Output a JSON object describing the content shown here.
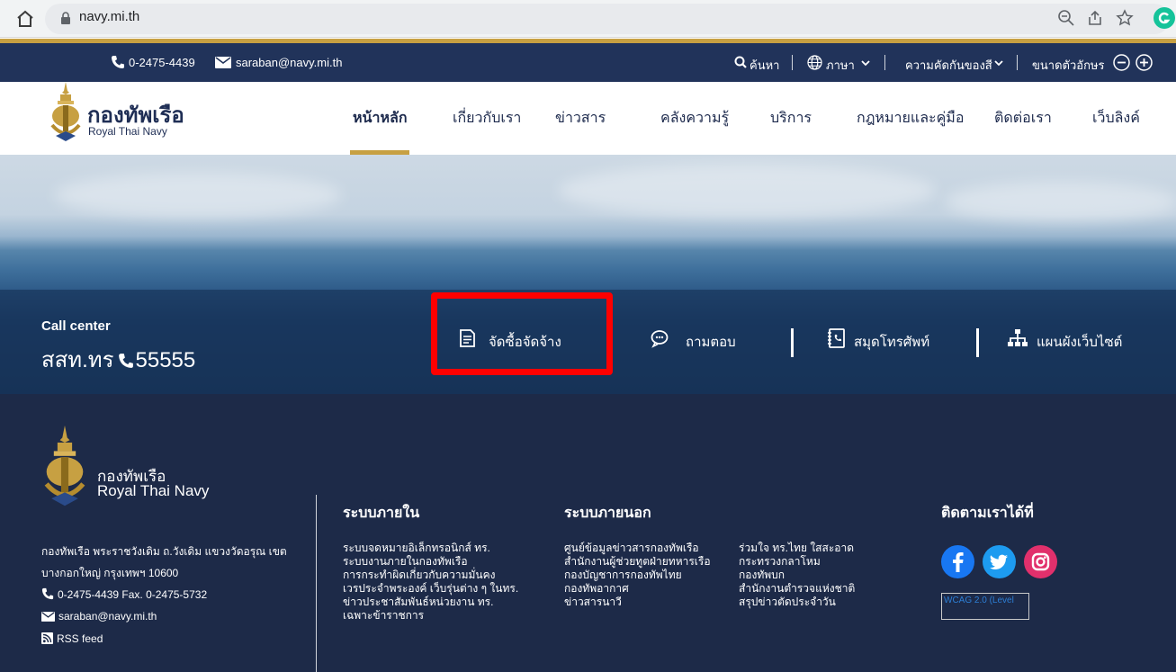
{
  "browser": {
    "url": "navy.mi.th"
  },
  "utility": {
    "phone": "0-2475-4439",
    "email": "saraban@navy.mi.th",
    "search": "ค้นหา",
    "language": "ภาษา",
    "contrast": "ความคัดกันของสี",
    "font_size": "ขนาดตัวอักษร"
  },
  "header": {
    "logo_th": "กองทัพเรือ",
    "logo_en": "Royal Thai Navy",
    "nav": [
      "หน้าหลัก",
      "เกี่ยวกับเรา",
      "ข่าวสาร",
      "คลังความรู้",
      "บริการ",
      "กฎหมายและคู่มือ",
      "ติดต่อเรา",
      "เว็บลิงค์"
    ]
  },
  "hero": {
    "call_center_label": "Call center",
    "call_center_prefix": "สสท.ทร",
    "call_center_number": "55555",
    "quick_links": [
      "จัดซื้อจัดจ้าง",
      "ถามตอบ",
      "สมุดโทรศัพท์",
      "แผนผังเว็บไซต์"
    ]
  },
  "footer": {
    "logo_th": "กองทัพเรือ",
    "logo_en": "Royal Thai Navy",
    "address": "กองทัพเรือ พระราชวังเดิม ถ.วังเดิม แขวงวัดอรุณ เขตบางกอกใหญ่ กรุงเทพฯ 10600",
    "phone_fax": "0-2475-4439 Fax. 0-2475-5732",
    "email": "saraban@navy.mi.th",
    "rss": "RSS feed",
    "internal_heading": "ระบบภายใน",
    "internal_links": [
      "ระบบจดหมายอิเล็กทรอนิกส์ ทร.",
      "ระบบงานภายในกองทัพเรือ",
      "การกระทำผิดเกี่ยวกับความมั่นคง",
      "เวรประจำพระองค์ เว็บรุ่นต่าง ๆ ในทร.",
      "ข่าวประชาสัมพันธ์หน่วยงาน ทร.",
      "เฉพาะข้าราชการ"
    ],
    "external_heading": "ระบบภายนอก",
    "external_links_col1": [
      "ศูนย์ข้อมูลข่าวสารกองทัพเรือ",
      "สำนักงานผู้ช่วยทูตฝ่ายทหารเรือ",
      "กองบัญชาการกองทัพไทย",
      "กองทัพอากาศ",
      "ข่าวสารนาวี"
    ],
    "external_links_col2": [
      "ร่วมใจ ทร.ไทย ใสสะอาด",
      "กระทรวงกลาโหม",
      "กองทัพบก",
      "สำนักงานตำรวจแห่งชาติ",
      "สรุปข่าวตัดประจำวัน"
    ],
    "follow_heading": "ติดตามเราได้ที่",
    "wcag_alt": "WCAG 2.0 (Level"
  },
  "colors": {
    "navy_dark": "#1d2a48",
    "util_bar": "#21335a",
    "gold": "#c7a042",
    "highlight": "#ff0000",
    "facebook": "#1877f2",
    "twitter": "#1d9bf0",
    "instagram": "#e1306c"
  }
}
